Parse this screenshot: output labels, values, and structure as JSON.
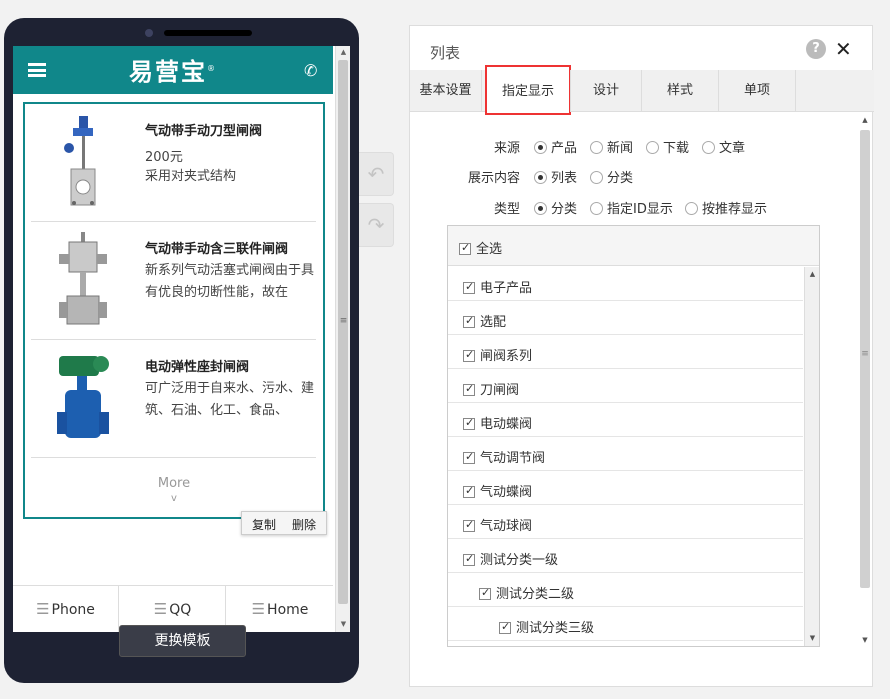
{
  "phone": {
    "logo": "易营宝",
    "logo_mark": "®",
    "products": [
      {
        "name": "气动带手动刀型闸阀",
        "price": "200元",
        "desc": "采用对夹式结构"
      },
      {
        "name": "气动带手动含三联件闸阀",
        "price": "",
        "desc": "新系列气动活塞式闸阀由于具有优良的切断性能，故在"
      },
      {
        "name": "电动弹性座封闸阀",
        "price": "",
        "desc": "可广泛用于自来水、污水、建筑、石油、化工、食品、"
      }
    ],
    "more_label": "More",
    "copy_label": "复制",
    "delete_label": "删除",
    "nav": [
      {
        "label": "Phone"
      },
      {
        "label": "QQ"
      },
      {
        "label": "Home"
      }
    ]
  },
  "change_template_label": "更换模板",
  "dialog": {
    "title": "列表",
    "tabs": [
      {
        "label": "基本设置"
      },
      {
        "label": "指定显示"
      },
      {
        "label": "设计"
      },
      {
        "label": "样式"
      },
      {
        "label": "单项"
      }
    ],
    "active_tab": "指定显示",
    "source": {
      "label": "来源",
      "options": [
        "产品",
        "新闻",
        "下载",
        "文章"
      ],
      "selected": "产品"
    },
    "content": {
      "label": "展示内容",
      "options": [
        "列表",
        "分类"
      ],
      "selected": "列表"
    },
    "type": {
      "label": "类型",
      "options": [
        "分类",
        "指定ID显示",
        "按推荐显示"
      ],
      "selected": "分类"
    },
    "select_all_label": "全选",
    "categories": [
      {
        "label": "电子产品",
        "level": 1,
        "checked": true
      },
      {
        "label": "选配",
        "level": 1,
        "checked": true
      },
      {
        "label": "闸阀系列",
        "level": 1,
        "checked": true
      },
      {
        "label": "刀闸阀",
        "level": 1,
        "checked": true
      },
      {
        "label": "电动蝶阀",
        "level": 1,
        "checked": true
      },
      {
        "label": "气动调节阀",
        "level": 1,
        "checked": true
      },
      {
        "label": "气动蝶阀",
        "level": 1,
        "checked": true
      },
      {
        "label": "气动球阀",
        "level": 1,
        "checked": true
      },
      {
        "label": "测试分类一级",
        "level": 1,
        "checked": true
      },
      {
        "label": "测试分类二级",
        "level": 2,
        "checked": true
      },
      {
        "label": "测试分类三级",
        "level": 3,
        "checked": true
      }
    ]
  },
  "colors": {
    "accent": "#10878a",
    "active_tab_border": "#ee3333",
    "phone_frame": "#1e2233"
  }
}
